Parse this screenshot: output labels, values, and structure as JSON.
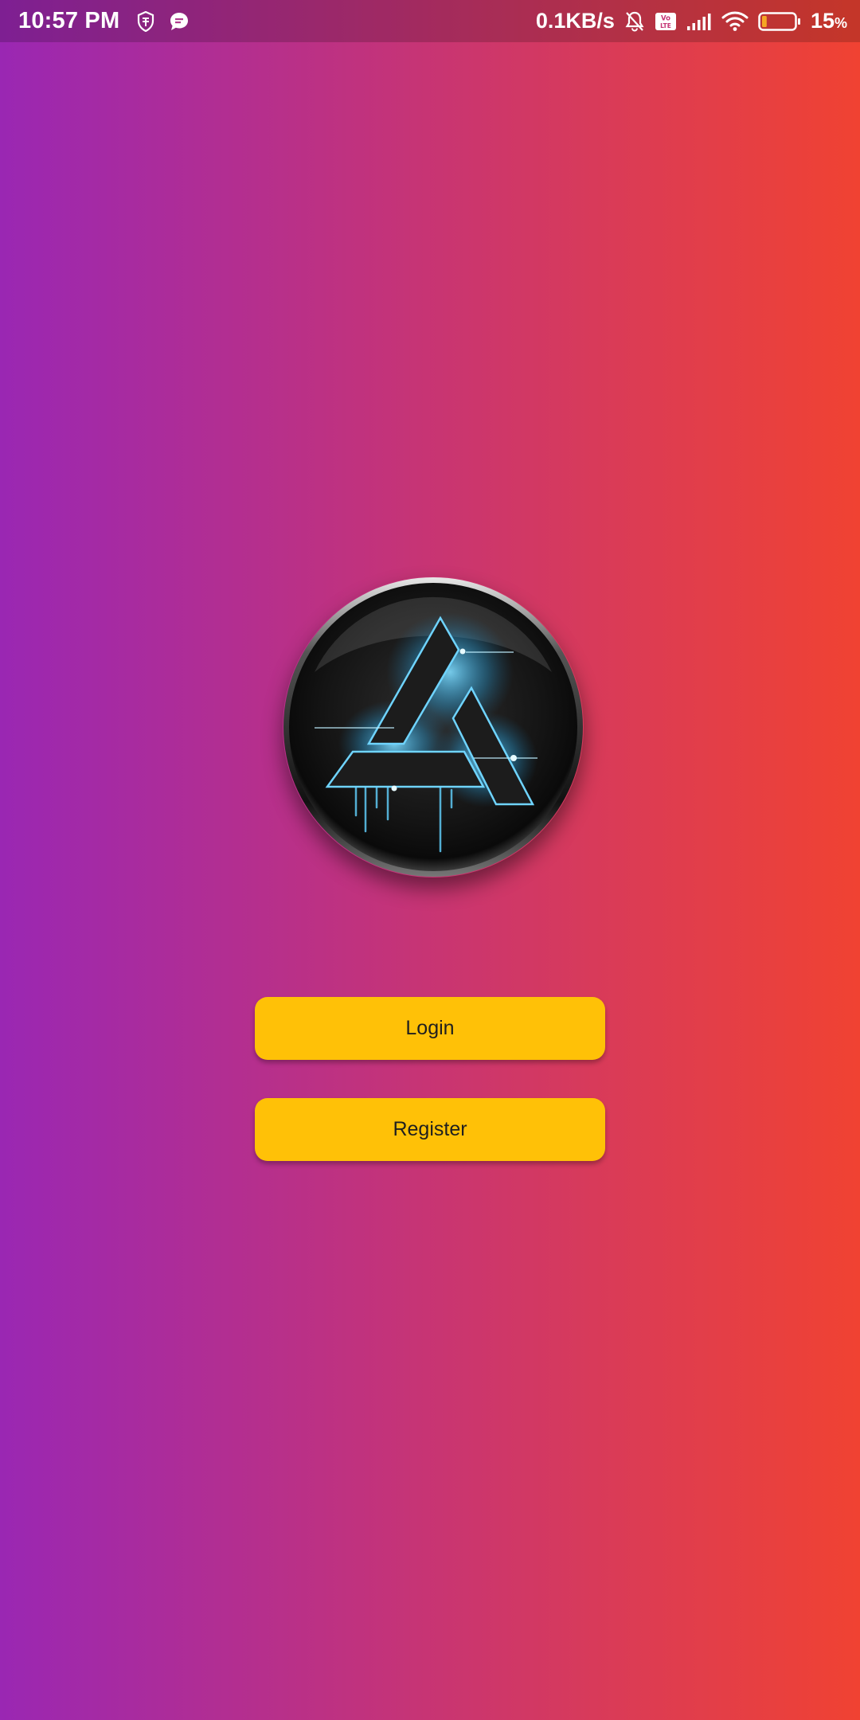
{
  "status_bar": {
    "time": "10:57 PM",
    "network_speed": "0.1KB/s",
    "battery_percent": "15",
    "battery_percent_symbol": "%",
    "battery_level": 0.15,
    "icons": [
      "shield-app-icon",
      "chat-bubble-icon",
      "bell-off-icon",
      "volte-icon",
      "signal-icon",
      "wifi-icon",
      "battery-icon"
    ]
  },
  "logo": {
    "description_icon": "triangle-logo-icon"
  },
  "actions": {
    "login_label": "Login",
    "register_label": "Register"
  },
  "colors": {
    "gradient_left": "#9a27b3",
    "gradient_right": "#f04232",
    "button": "#ffc107",
    "logo_glow": "#4fc3f7",
    "battery_low": "#f5a623"
  }
}
